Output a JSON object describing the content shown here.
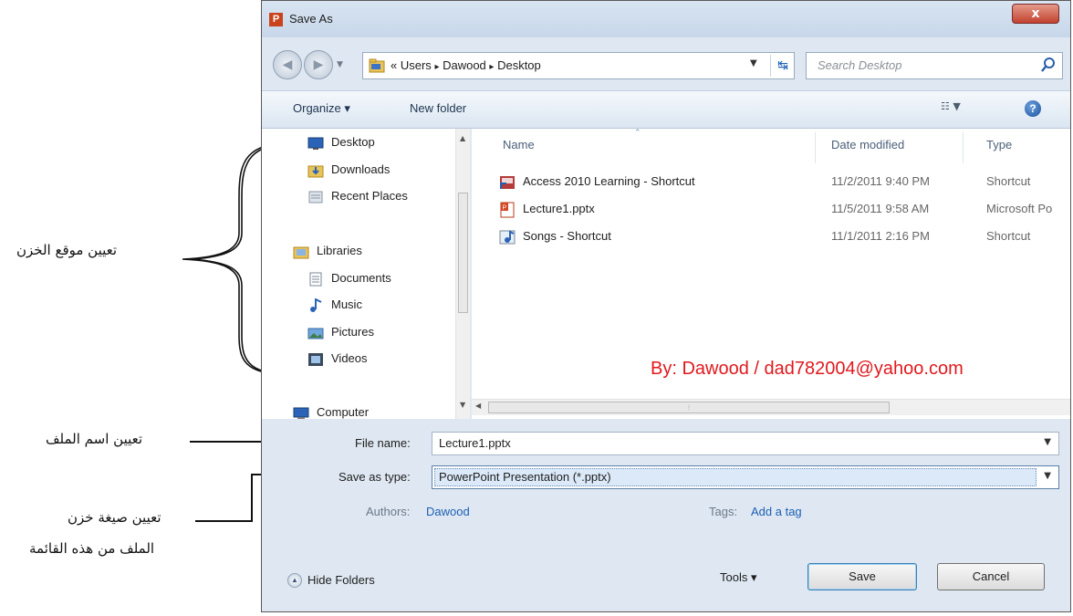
{
  "window": {
    "title": "Save As",
    "app_icon_letter": "P",
    "close_glyph": "x"
  },
  "address": {
    "crumbs": [
      "«",
      "Users",
      "▸",
      "Dawood",
      "▸",
      "Desktop"
    ],
    "search_placeholder": "Search Desktop"
  },
  "toolbar": {
    "organize_label": "Organize ▾",
    "new_folder_label": "New folder",
    "help_glyph": "?"
  },
  "nav": {
    "items": [
      {
        "label": "Desktop",
        "icon": "desktop-icon"
      },
      {
        "label": "Downloads",
        "icon": "downloads-folder-icon"
      },
      {
        "label": "Recent Places",
        "icon": "recent-places-icon"
      },
      {
        "label": "Libraries",
        "icon": "libraries-icon"
      },
      {
        "label": "Documents",
        "icon": "documents-icon"
      },
      {
        "label": "Music",
        "icon": "music-icon"
      },
      {
        "label": "Pictures",
        "icon": "pictures-icon"
      },
      {
        "label": "Videos",
        "icon": "videos-icon"
      },
      {
        "label": "Computer",
        "icon": "computer-icon"
      }
    ]
  },
  "files": {
    "columns": [
      "Name",
      "Date modified",
      "Type"
    ],
    "rows": [
      {
        "name": "Access 2010 Learning - Shortcut",
        "date": "11/2/2011 9:40 PM",
        "type": "Shortcut",
        "icon": "shortcut-icon"
      },
      {
        "name": "Lecture1.pptx",
        "date": "11/5/2011 9:58 AM",
        "type": "Microsoft Po",
        "icon": "pptx-file-icon"
      },
      {
        "name": "Songs - Shortcut",
        "date": "11/1/2011 2:16 PM",
        "type": "Shortcut",
        "icon": "music-shortcut-icon"
      }
    ],
    "watermark": "By: Dawood / dad782004@yahoo.com"
  },
  "form": {
    "file_name_label": "File name:",
    "file_name_value": "Lecture1.pptx",
    "save_type_label": "Save as type:",
    "save_type_value": "PowerPoint Presentation (*.pptx)",
    "authors_label": "Authors:",
    "authors_value": "Dawood",
    "tags_label": "Tags:",
    "tags_value": "Add a tag"
  },
  "footer": {
    "hide_folders_label": "Hide Folders",
    "tools_label": "Tools ▾",
    "save_label": "Save",
    "cancel_label": "Cancel"
  },
  "annotations": {
    "save_location": "تعيين موقع الخزن",
    "file_name": "تعيين اسم الملف",
    "file_format_line1": "تعيين صيغة خزن",
    "file_format_line2": "الملف من هذه القائمة"
  },
  "colors": {
    "accent": "#1d5fb4",
    "watermark": "#e0191e",
    "frame": "#dfe8f2"
  }
}
